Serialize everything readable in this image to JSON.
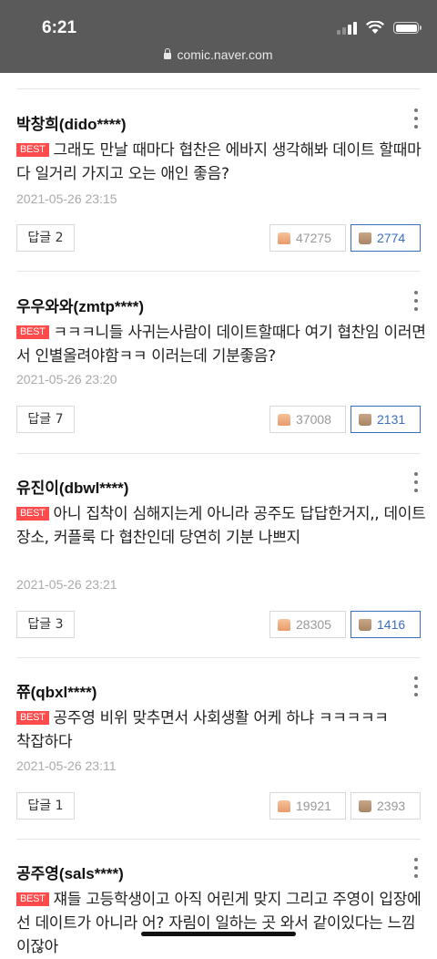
{
  "status": {
    "time": "6:21",
    "url": "comic.naver.com"
  },
  "best_label": "BEST",
  "reply_prefix": "답글",
  "comments": [
    {
      "name": "박창희(dido****)",
      "text": "그래도 만날 때마다 협찬은 에바지 생각해봐 데이트 할때마다 일거리 가지고 오는 애인 좋음?",
      "date": "2021-05-26 23:15",
      "replies": "2",
      "likes": "47275",
      "dislikes": "2774"
    },
    {
      "name": "우우와와(zmtp****)",
      "text": "ㅋㅋㅋ니들 사귀는사람이 데이트할때다 여기 협찬임 이러면서 인별올려야함ㅋㅋ 이러는데 기분좋음?",
      "date": "2021-05-26 23:20",
      "replies": "7",
      "likes": "37008",
      "dislikes": "2131"
    },
    {
      "name": "유진이(dbwl****)",
      "text": "아니 집착이 심해지는게 아니라 공주도 답답한거지,, 데이트 장소, 커플룩 다 협찬인데 당연히 기분 나쁘지",
      "date": "2021-05-26 23:21",
      "replies": "3",
      "likes": "28305",
      "dislikes": "1416"
    },
    {
      "name": "쮸(qbxl****)",
      "text": "공주영 비위 맞추면서 사회생활 어케 하냐 ㅋㅋㅋㅋㅋ 착잡하다",
      "date": "2021-05-26 23:11",
      "replies": "1",
      "likes": "19921",
      "dislikes": "2393"
    },
    {
      "name": "공주영(sals****)",
      "text": "쟤들 고등학생이고 아직 어린게 맞지 그리고 주영이 입장에선 데이트가 아니라 어? 자림이 일하는 곳 와서 같이있다는 느낌이잖아"
    }
  ],
  "colors": {
    "best": "#ff4b4b",
    "dislike_active": "#3b6ec2",
    "status_bar": "#5a5a5a"
  }
}
